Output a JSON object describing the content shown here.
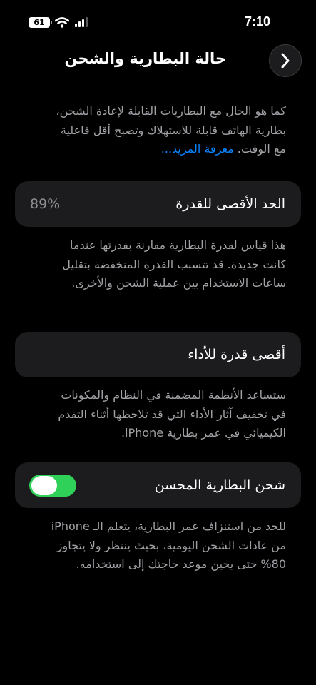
{
  "status_bar": {
    "time": "7:10",
    "battery_percent": "61"
  },
  "nav": {
    "title": "حالة البطارية والشحن"
  },
  "intro": {
    "text": "كما هو الحال مع البطاريات القابلة لإعادة الشحن، بطارية الهاتف قابلة للاستهلاك وتصبح أقل فاعلية مع الوقت.",
    "link": "معرفة المزيد..."
  },
  "max_capacity": {
    "label": "الحد الأقصى للقدرة",
    "value": "89%",
    "description": "هذا قياس لقدرة البطارية مقارنة بقدرتها عندما كانت جديدة. قد تتسبب القدرة المنخفضة بتقليل ساعات الاستخدام بين عملية الشحن والأخرى."
  },
  "peak_performance": {
    "label": "أقصى قدرة للأداء",
    "description": "ستساعد الأنظمة المضمنة في النظام والمكونات في تخفيف آثار الأداء التي قد تلاحظها أثناء التقدم الكيميائي في عمر بطارية iPhone."
  },
  "optimized_charging": {
    "label": "شحن البطارية المحسن",
    "enabled": true,
    "description": "للحد من استنزاف عمر البطارية، يتعلم الـ iPhone من عادات الشحن اليومية، بحيث ينتظر ولا يتجاوز 80% حتى يحين موعد حاجتك إلى استخدامه."
  },
  "colors": {
    "background": "#000000",
    "card": "#1c1c1e",
    "secondary_text": "#a1a1a6",
    "link": "#0a84ff",
    "toggle_on": "#30d158"
  }
}
